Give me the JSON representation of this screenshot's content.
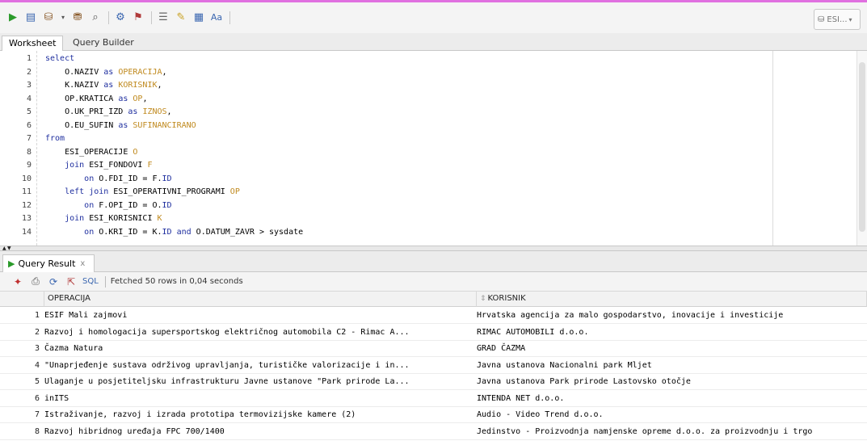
{
  "toolbar": {
    "connection_label": "ESI...",
    "icons": [
      "run-statement-icon",
      "run-script-icon",
      "commit-icon",
      "dropdown-arrow-icon",
      "rollback-icon",
      "autotrace-icon",
      "explain-plan-icon",
      "sql-tuning-icon",
      "sql-history-icon",
      "clear-icon",
      "format-icon",
      "find-replace-icon"
    ]
  },
  "tabs": {
    "worksheet": "Worksheet",
    "query_builder": "Query Builder"
  },
  "editor": {
    "lines": [
      {
        "n": "1",
        "parts": [
          [
            "kw",
            "select"
          ]
        ]
      },
      {
        "n": "2",
        "parts": [
          [
            "t",
            "    O.NAZIV "
          ],
          [
            "kw",
            "as"
          ],
          [
            "t",
            " "
          ],
          [
            "al",
            "OPERACIJA"
          ],
          [
            "t",
            ","
          ]
        ]
      },
      {
        "n": "3",
        "parts": [
          [
            "t",
            "    K.NAZIV "
          ],
          [
            "kw",
            "as"
          ],
          [
            "t",
            " "
          ],
          [
            "al",
            "KORISNIK"
          ],
          [
            "t",
            ","
          ]
        ]
      },
      {
        "n": "4",
        "parts": [
          [
            "t",
            "    OP.KRATICA "
          ],
          [
            "kw",
            "as"
          ],
          [
            "t",
            " "
          ],
          [
            "al",
            "OP"
          ],
          [
            "t",
            ","
          ]
        ]
      },
      {
        "n": "5",
        "parts": [
          [
            "t",
            "    O.UK_PRI_IZD "
          ],
          [
            "kw",
            "as"
          ],
          [
            "t",
            " "
          ],
          [
            "al",
            "IZNOS"
          ],
          [
            "t",
            ","
          ]
        ]
      },
      {
        "n": "6",
        "parts": [
          [
            "t",
            "    O.EU_SUFIN "
          ],
          [
            "kw",
            "as"
          ],
          [
            "t",
            " "
          ],
          [
            "al",
            "SUFINANCIRANO"
          ]
        ]
      },
      {
        "n": "7",
        "parts": [
          [
            "kw",
            "from"
          ]
        ]
      },
      {
        "n": "8",
        "parts": [
          [
            "t",
            "    ESI_OPERACIJE "
          ],
          [
            "al",
            "O"
          ]
        ]
      },
      {
        "n": "9",
        "parts": [
          [
            "t",
            "    "
          ],
          [
            "kw",
            "join"
          ],
          [
            "t",
            " ESI_FONDOVI "
          ],
          [
            "al",
            "F"
          ]
        ]
      },
      {
        "n": "10",
        "parts": [
          [
            "t",
            "        "
          ],
          [
            "kw",
            "on"
          ],
          [
            "t",
            " O.FDI_ID = F."
          ],
          [
            "kw",
            "ID"
          ]
        ]
      },
      {
        "n": "11",
        "parts": [
          [
            "t",
            "    "
          ],
          [
            "kw",
            "left join"
          ],
          [
            "t",
            " ESI_OPERATIVNI_PROGRAMI "
          ],
          [
            "al",
            "OP"
          ]
        ]
      },
      {
        "n": "12",
        "parts": [
          [
            "t",
            "        "
          ],
          [
            "kw",
            "on"
          ],
          [
            "t",
            " F.OPI_ID = O."
          ],
          [
            "kw",
            "ID"
          ]
        ]
      },
      {
        "n": "13",
        "parts": [
          [
            "t",
            "    "
          ],
          [
            "kw",
            "join"
          ],
          [
            "t",
            " ESI_KORISNICI "
          ],
          [
            "al",
            "K"
          ]
        ]
      },
      {
        "n": "14",
        "parts": [
          [
            "t",
            "        "
          ],
          [
            "kw",
            "on"
          ],
          [
            "t",
            " O.KRI_ID = K."
          ],
          [
            "kw",
            "ID"
          ],
          [
            "t",
            " "
          ],
          [
            "kw",
            "and"
          ],
          [
            "t",
            " O.DATUM_ZAVR > sysdate"
          ]
        ]
      }
    ]
  },
  "result_tab": {
    "label": "Query Result",
    "close": "x"
  },
  "result_toolbar": {
    "sql_label": "SQL",
    "status": "Fetched 50 rows in 0,04 seconds"
  },
  "grid": {
    "headers": [
      "OPERACIJA",
      "KORISNIK"
    ],
    "rows": [
      {
        "n": "1",
        "operacija": "ESIF Mali zajmovi",
        "korisnik": "Hrvatska agencija za malo gospodarstvo, inovacije i investicije"
      },
      {
        "n": "2",
        "operacija": "Razvoj i homologacija supersportskog električnog automobila C2 - Rimac A...",
        "korisnik": "RIMAC AUTOMOBILI d.o.o."
      },
      {
        "n": "3",
        "operacija": "Čazma Natura",
        "korisnik": "GRAD ČAZMA"
      },
      {
        "n": "4",
        "operacija": "\"Unaprjeđenje sustava održivog upravljanja, turističke valorizacije i in...",
        "korisnik": "Javna ustanova Nacionalni park Mljet"
      },
      {
        "n": "5",
        "operacija": "Ulaganje u posjetiteljsku infrastrukturu Javne ustanove \"Park prirode La...",
        "korisnik": "Javna ustanova Park prirode Lastovsko otočje"
      },
      {
        "n": "6",
        "operacija": "inITS",
        "korisnik": "INTENDA NET d.o.o."
      },
      {
        "n": "7",
        "operacija": "Istraživanje, razvoj i izrada prototipa termovizijske kamere (2)",
        "korisnik": "Audio - Video Trend d.o.o."
      },
      {
        "n": "8",
        "operacija": "Razvoj hibridnog uređaja FPC 700/1400",
        "korisnik": "Jedinstvo - Proizvodnja namjenske opreme d.o.o. za proizvodnju i trgo"
      }
    ]
  },
  "colors": {
    "keyword": "#1f2f9f",
    "alias": "#c08a1f",
    "accent_top": "#e070e0"
  }
}
